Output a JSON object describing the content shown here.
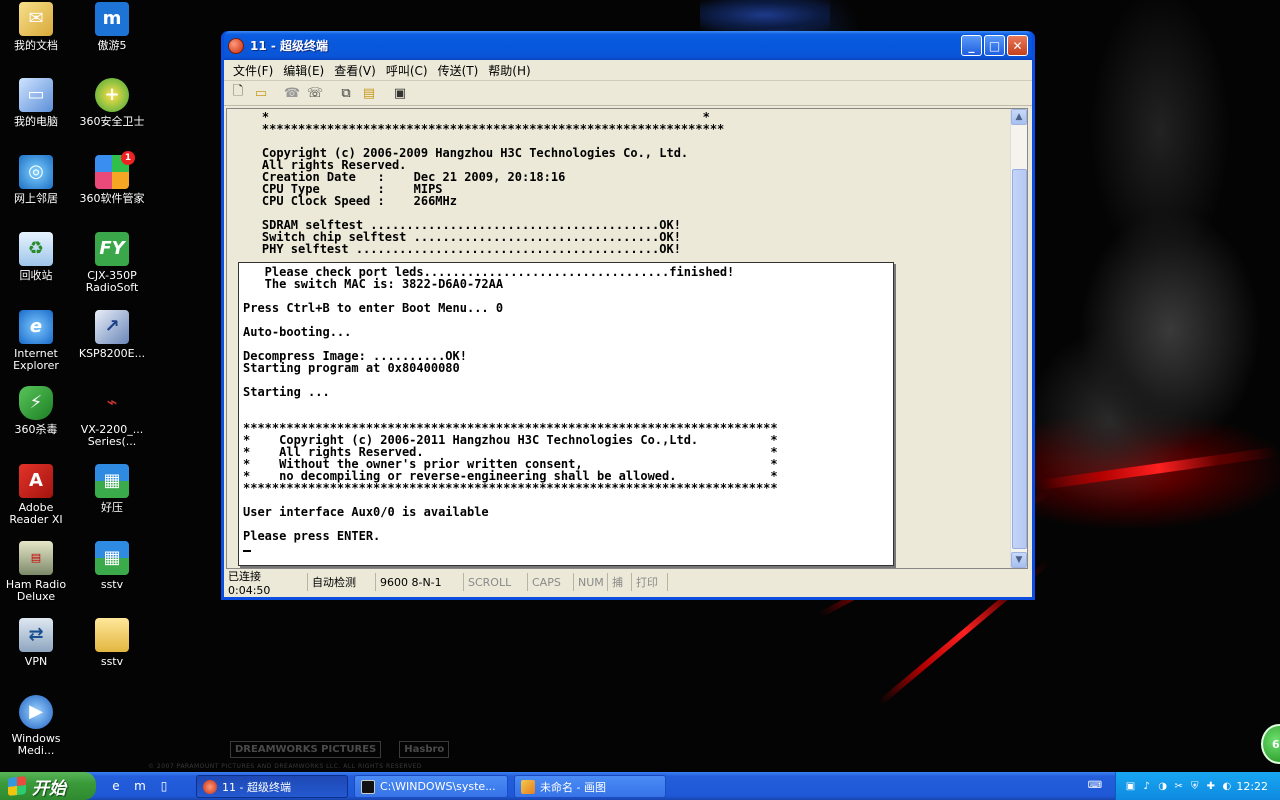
{
  "desktop": {
    "icons": [
      {
        "label": "我的文档"
      },
      {
        "label": "傲游5"
      },
      {
        "label": "我的电脑"
      },
      {
        "label": "360安全卫士"
      },
      {
        "label": "网上邻居"
      },
      {
        "label": "360软件管家"
      },
      {
        "label": "回收站"
      },
      {
        "label": "CJX-350P\nRadioSoft"
      },
      {
        "label": "Internet\nExplorer"
      },
      {
        "label": "KSP8200E..."
      },
      {
        "label": "360杀毒"
      },
      {
        "label": "VX-2200_...\nSeries(..."
      },
      {
        "label": "Adobe\nReader XI"
      },
      {
        "label": "好压"
      },
      {
        "label": "Ham Radio\nDeluxe"
      },
      {
        "label": "sstv"
      },
      {
        "label": "VPN"
      },
      {
        "label": "sstv"
      },
      {
        "label": "Windows\nMedi..."
      }
    ],
    "wallpaper_logos": [
      "DREAMWORKS PICTURES",
      "Hasbro"
    ],
    "wallpaper_fine": "© 2007 PARAMOUNT PICTURES AND DREAMWORKS LLC. ALL RIGHTS RESERVED",
    "badge_count": "1",
    "tray_bubble": "6"
  },
  "window": {
    "title": "11 - 超级终端",
    "buttons": {
      "minimize": "_",
      "maximize": "□",
      "close": "✕"
    },
    "menu": [
      "文件(F)",
      "编辑(E)",
      "查看(V)",
      "呼叫(C)",
      "传送(T)",
      "帮助(H)"
    ],
    "toolbar_icons": [
      "new-icon",
      "open-icon",
      "disconnect-icon",
      "call-icon",
      "send-icon",
      "receive-icon",
      "properties-icon"
    ],
    "terminal": {
      "back_text": "    *                                                            *\n    ****************************************************************\n\n    Copyright (c) 2006-2009 Hangzhou H3C Technologies Co., Ltd.\n    All rights Reserved.\n    Creation Date   :    Dec 21 2009, 20:18:16\n    CPU Type        :    MIPS\n    CPU Clock Speed :    266MHz\n\n    SDRAM selftest ........................................OK!\n    Switch chip selftest ..................................OK!\n    PHY selftest ..........................................OK!",
      "front_text": "   Please check port leds..................................finished!\n   The switch MAC is: 3822-D6A0-72AA\n\nPress Ctrl+B to enter Boot Menu... 0\n\nAuto-booting...\n\nDecompress Image: ..........OK!\nStarting program at 0x80400080\n\nStarting ...\n\n\n**************************************************************************\n*    Copyright (c) 2006-2011 Hangzhou H3C Technologies Co.,Ltd.          *\n*    All rights Reserved.                                                *\n*    Without the owner's prior written consent,                          *\n*    no decompiling or reverse-engineering shall be allowed.             *\n**************************************************************************\n\nUser interface Aux0/0 is available\n\nPlease press ENTER."
    },
    "status": {
      "connection": "已连接 0:04:50",
      "detect": "自动检测",
      "settings": "9600 8-N-1",
      "scroll": "SCROLL",
      "caps": "CAPS",
      "num": "NUM",
      "capture": "捕",
      "print": "打印"
    }
  },
  "taskbar": {
    "start_label": "开始",
    "tasks": [
      {
        "label": "11 - 超级终端",
        "active": true
      },
      {
        "label": "C:\\WINDOWS\\syste...",
        "active": false
      },
      {
        "label": "未命名 - 画图",
        "active": false
      }
    ],
    "clock": "12:22"
  }
}
